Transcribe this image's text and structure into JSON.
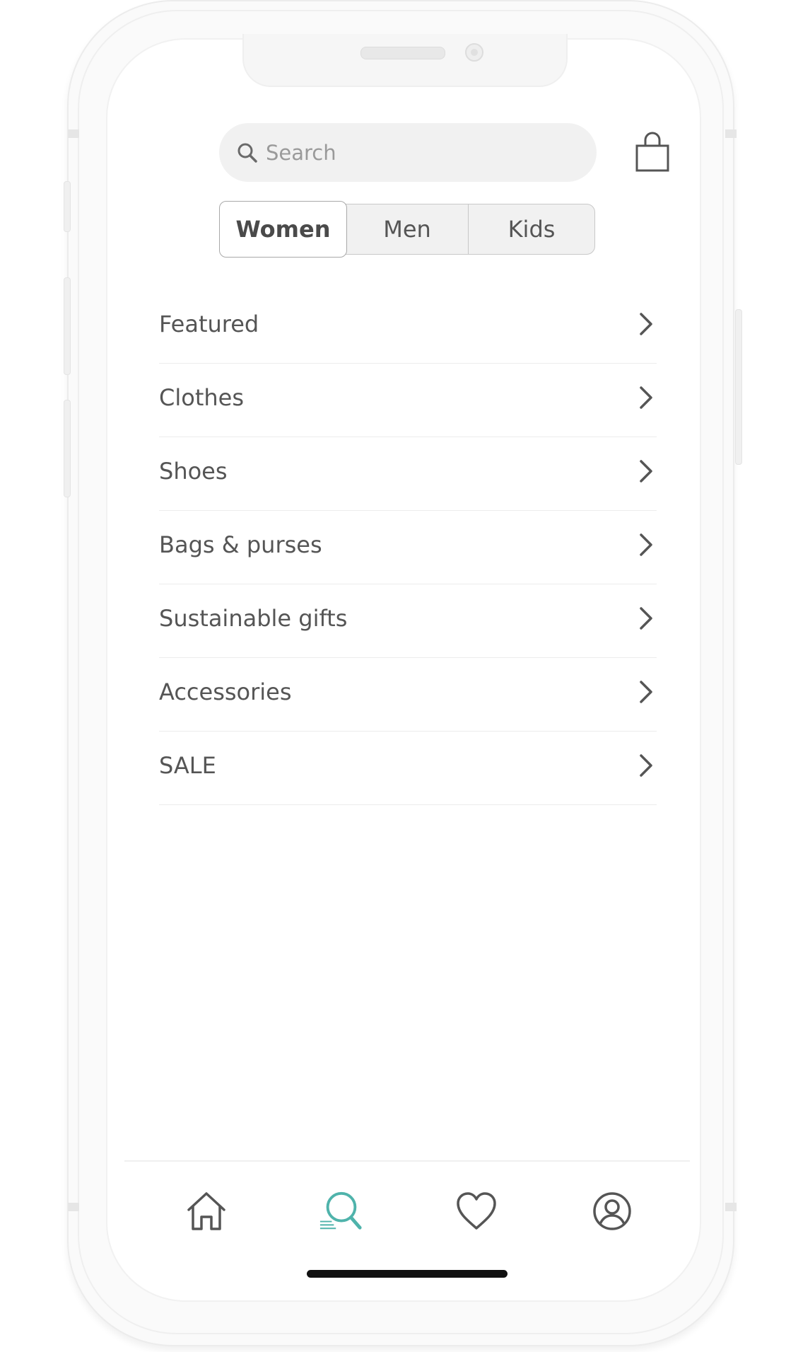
{
  "search": {
    "placeholder": "Search"
  },
  "segments": {
    "selected": "Women",
    "items": [
      {
        "label": "Women",
        "selected": true
      },
      {
        "label": "Men",
        "selected": false
      },
      {
        "label": "Kids",
        "selected": false
      }
    ]
  },
  "categories": [
    {
      "label": "Featured"
    },
    {
      "label": "Clothes"
    },
    {
      "label": "Shoes"
    },
    {
      "label": "Bags & purses"
    },
    {
      "label": "Sustainable gifts"
    },
    {
      "label": "Accessories"
    },
    {
      "label": "SALE"
    }
  ],
  "nav": {
    "items": [
      {
        "icon": "home-icon",
        "active": false
      },
      {
        "icon": "search-icon",
        "active": true
      },
      {
        "icon": "heart-icon",
        "active": false
      },
      {
        "icon": "profile-icon",
        "active": false
      }
    ]
  },
  "colors": {
    "accent": "#4fb3ab",
    "icon": "#555555",
    "text": "#555555"
  }
}
